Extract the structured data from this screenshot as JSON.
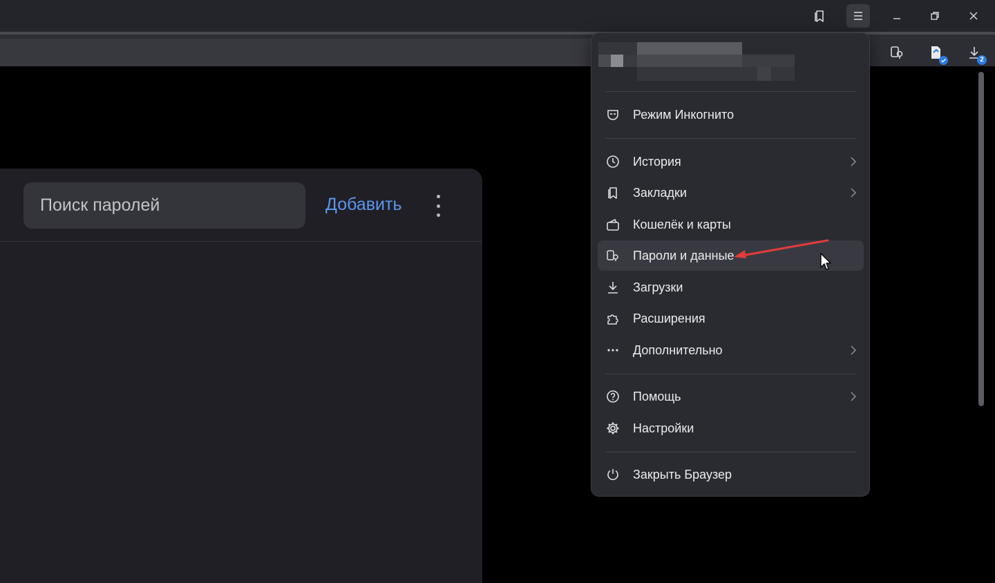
{
  "passwords_page": {
    "search_placeholder": "Поиск паролей",
    "add_label": "Добавить"
  },
  "downloads_badge": "2",
  "menu": {
    "items": [
      {
        "label": "Режим Инкогнито",
        "icon": "incognito-mask-icon"
      },
      {
        "label": "История",
        "icon": "clock-icon",
        "submenu": true
      },
      {
        "label": "Закладки",
        "icon": "bookmarks-icon",
        "submenu": true
      },
      {
        "label": "Кошелёк и карты",
        "icon": "wallet-icon"
      },
      {
        "label": "Пароли и данные",
        "icon": "passwords-icon",
        "highlighted": true
      },
      {
        "label": "Загрузки",
        "icon": "download-icon"
      },
      {
        "label": "Расширения",
        "icon": "puzzle-icon"
      },
      {
        "label": "Дополнительно",
        "icon": "more-dots-icon",
        "submenu": true
      },
      {
        "label": "Помощь",
        "icon": "help-icon",
        "submenu": true
      },
      {
        "label": "Настройки",
        "icon": "gear-icon"
      },
      {
        "label": "Закрыть Браузер",
        "icon": "power-icon"
      }
    ]
  }
}
